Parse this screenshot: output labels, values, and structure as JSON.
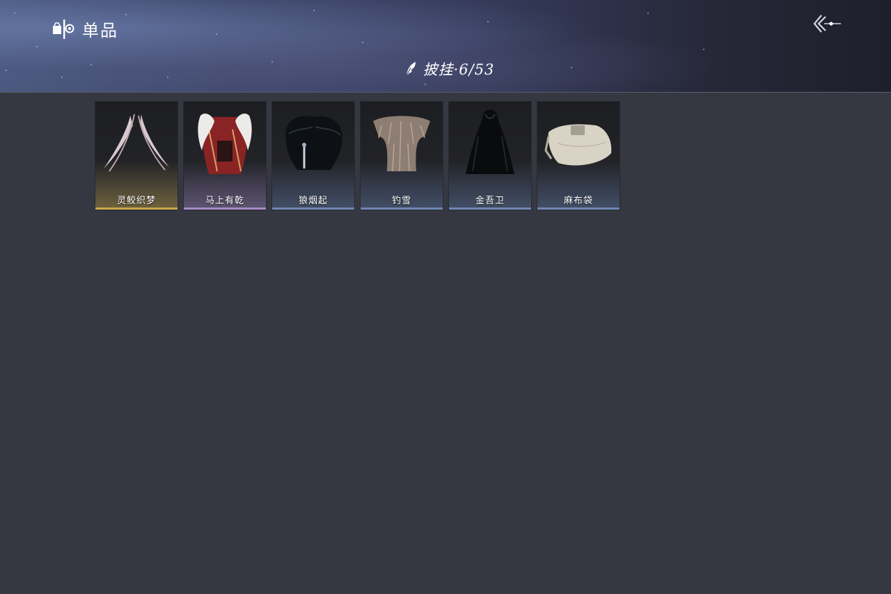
{
  "header": {
    "title": "单品",
    "title_icon": "wardrobe-icon",
    "back_icon": "back-arrow-icon"
  },
  "category": {
    "icon": "feather-icon",
    "label": "披挂·6/53"
  },
  "items": [
    {
      "name": "灵鲛织梦",
      "icon": "ribbon-sash-icon",
      "rarity_color": "#c9a84a"
    },
    {
      "name": "马上有乾",
      "icon": "fur-collar-robe-icon",
      "rarity_color": "#a58bc4"
    },
    {
      "name": "狼烟起",
      "icon": "dark-fur-cape-icon",
      "rarity_color": "#6d88b5"
    },
    {
      "name": "钓雪",
      "icon": "straw-cape-icon",
      "rarity_color": "#6d88b5"
    },
    {
      "name": "金吾卫",
      "icon": "hooded-black-cloak-icon",
      "rarity_color": "#6d88b5"
    },
    {
      "name": "麻布袋",
      "icon": "burlap-sack-icon",
      "rarity_color": "#6d88b5"
    }
  ]
}
